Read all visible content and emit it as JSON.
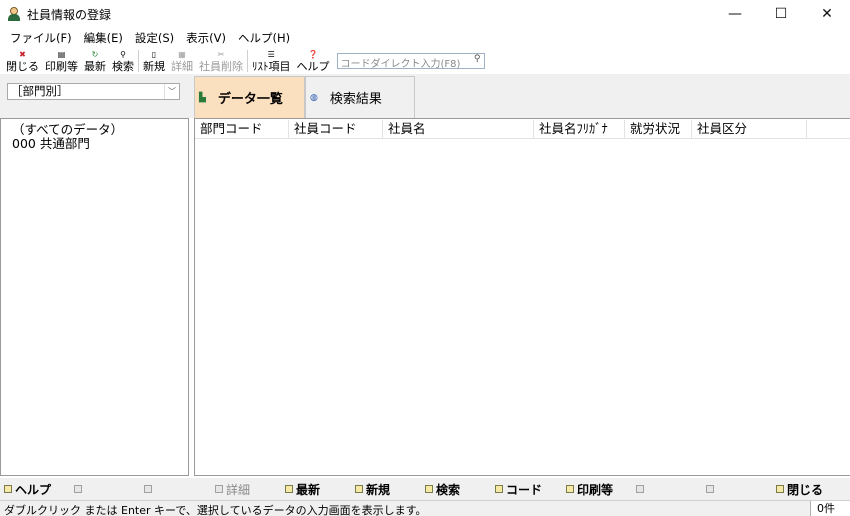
{
  "window": {
    "title": "社員情報の登録",
    "minimize": "—",
    "maximize": "☐",
    "close": "✕"
  },
  "menu": [
    "ファイル(F)",
    "編集(E)",
    "設定(S)",
    "表示(V)",
    "ヘルプ(H)"
  ],
  "toolbar": {
    "close": "閉じる",
    "print": "印刷等",
    "refresh": "最新",
    "search": "検索",
    "new": "新規",
    "detail": "詳細",
    "delete": "社員削除",
    "list_items": "ﾘｽﾄ項目",
    "help": "ヘルプ",
    "code_input_placeholder": "コードダイレクト入力(F8)"
  },
  "filter": {
    "selected": "［部門別］"
  },
  "tabs": {
    "active": "データ一覧",
    "inactive": "検索結果"
  },
  "tree": [
    "（すべてのデータ）",
    "000 共通部門"
  ],
  "grid": {
    "columns": [
      "部門コード",
      "社員コード",
      "社員名",
      "社員名ﾌﾘｶﾞﾅ",
      "就労状況",
      "社員区分"
    ]
  },
  "fkeys": {
    "f1": "ヘルプ",
    "f4": "詳細",
    "f5": "最新",
    "f6": "新規",
    "f7": "検索",
    "f8": "コード",
    "f9": "印刷等",
    "f12": "閉じる"
  },
  "status": {
    "message": "ダブルクリック または Enter キーで、選択しているデータの入力画面を表示します。",
    "count": "0件"
  },
  "colors": {
    "active_tab": "#fbe0c0",
    "panel_bg": "#f0f0f0"
  }
}
